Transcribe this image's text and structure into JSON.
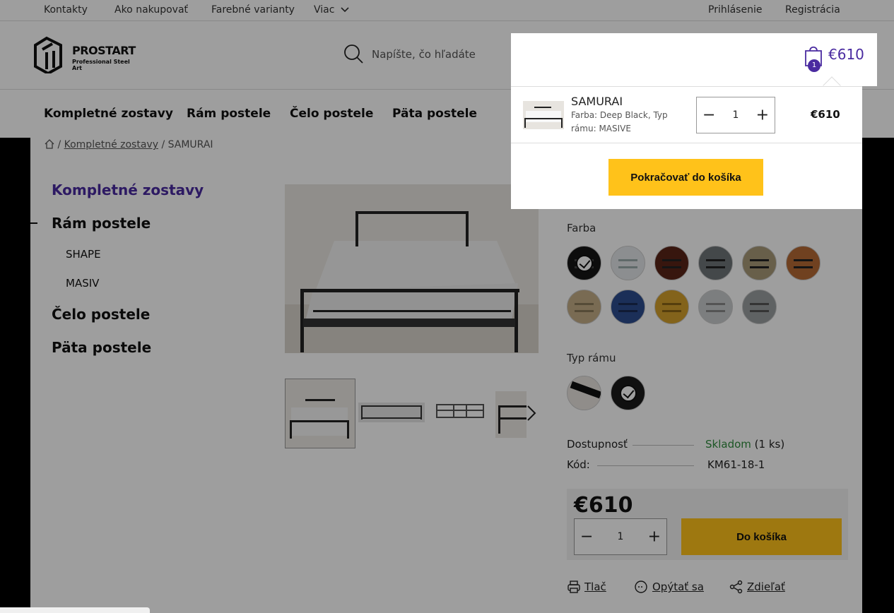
{
  "topbar": {
    "links": [
      "Kontakty",
      "Ako nakupovať",
      "Farebné varianty",
      "Viac"
    ],
    "login": "Prihlásenie",
    "register": "Registrácia"
  },
  "header": {
    "logo_title": "PROSTART",
    "logo_subtitle": "Professional Steel Art",
    "search_placeholder": "Napíšte, čo hľadáte"
  },
  "nav": {
    "items": [
      "Kompletné zostavy",
      "Rám postele",
      "Čelo postele",
      "Päta postele"
    ]
  },
  "breadcrumb": {
    "separator": "/",
    "category": "Kompletné zostavy",
    "current": "SAMURAI"
  },
  "sidebar": {
    "items": [
      {
        "label": "Kompletné zostavy"
      },
      {
        "label": "Rám postele"
      },
      {
        "label": "SHAPE"
      },
      {
        "label": "MASIV"
      },
      {
        "label": "Čelo postele"
      },
      {
        "label": "Päta postele"
      }
    ]
  },
  "product": {
    "color_label": "Farba",
    "frame_label": "Typ rámu",
    "availability_label": "Dostupnosť",
    "availability_value": "Skladom",
    "availability_count": "(1 ks)",
    "code_label": "Kód:",
    "code_value": "KM61-18-1",
    "price": "€610",
    "qty": "1",
    "add_to_cart": "Do košíka",
    "actions": [
      "Tlač",
      "Opýtať sa",
      "Zdieľať"
    ]
  },
  "cart": {
    "count": "1",
    "total": "€610",
    "item_name": "SAMURAI",
    "item_desc_1": "Farba: Deep Black, Typ",
    "item_desc_2": "rámu: MASIVE",
    "item_qty": "1",
    "item_price": "€610",
    "continue_label": "Pokračovať do košíka"
  },
  "colors": {
    "accent": "#4a2ba0",
    "button": "#ffc21a",
    "stock": "#2e8b3c"
  }
}
